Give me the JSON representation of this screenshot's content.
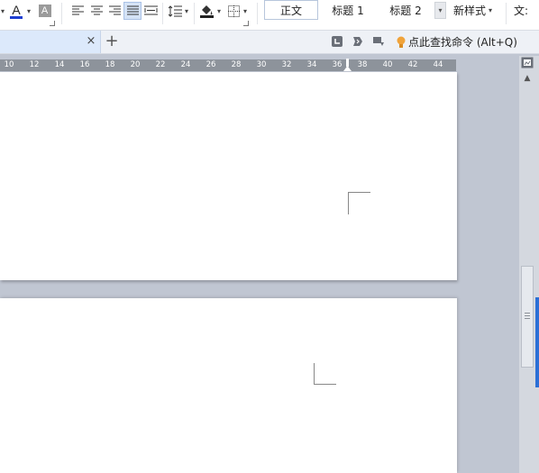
{
  "toolbar": {
    "font_color_glyph": "A",
    "highlight_glyph": "A",
    "styles": {
      "normal": "正文",
      "heading1": "标题 1",
      "heading2": "标题 2",
      "new_style": "新样式",
      "text_tools": "文:"
    }
  },
  "tabbar": {
    "close_glyph": "×",
    "add_glyph": "+",
    "search_command": "点此查找命令 (Alt+Q)"
  },
  "ruler": {
    "numbers": [
      "10",
      "12",
      "14",
      "16",
      "18",
      "20",
      "22",
      "24",
      "26",
      "28",
      "30",
      "32",
      "34",
      "36",
      "38",
      "40",
      "42",
      "44"
    ]
  },
  "colors": {
    "accent_blue": "#2b6fd6",
    "font_color_bar": "#1f3fd1",
    "ruler_bg": "#8d939b",
    "workspace_bg": "#c0c6d2"
  }
}
